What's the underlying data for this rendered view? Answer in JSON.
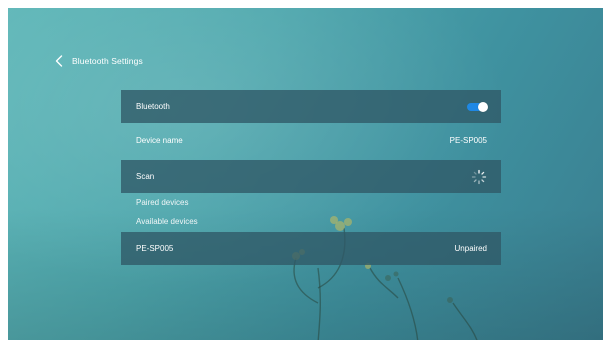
{
  "header": {
    "title": "Bluetooth Settings",
    "back_icon": "chevron-left-icon"
  },
  "bluetooth_row": {
    "label": "Bluetooth",
    "toggle_on": true,
    "toggle_color": "#1e88e5"
  },
  "device_name_row": {
    "label": "Device name",
    "value": "PE-SP005"
  },
  "scan_row": {
    "label": "Scan",
    "icon": "loading-spinner-icon"
  },
  "sections": {
    "paired": "Paired devices",
    "available": "Available devices"
  },
  "available_devices": [
    {
      "name": "PE-SP005",
      "status": "Unpaired"
    }
  ]
}
